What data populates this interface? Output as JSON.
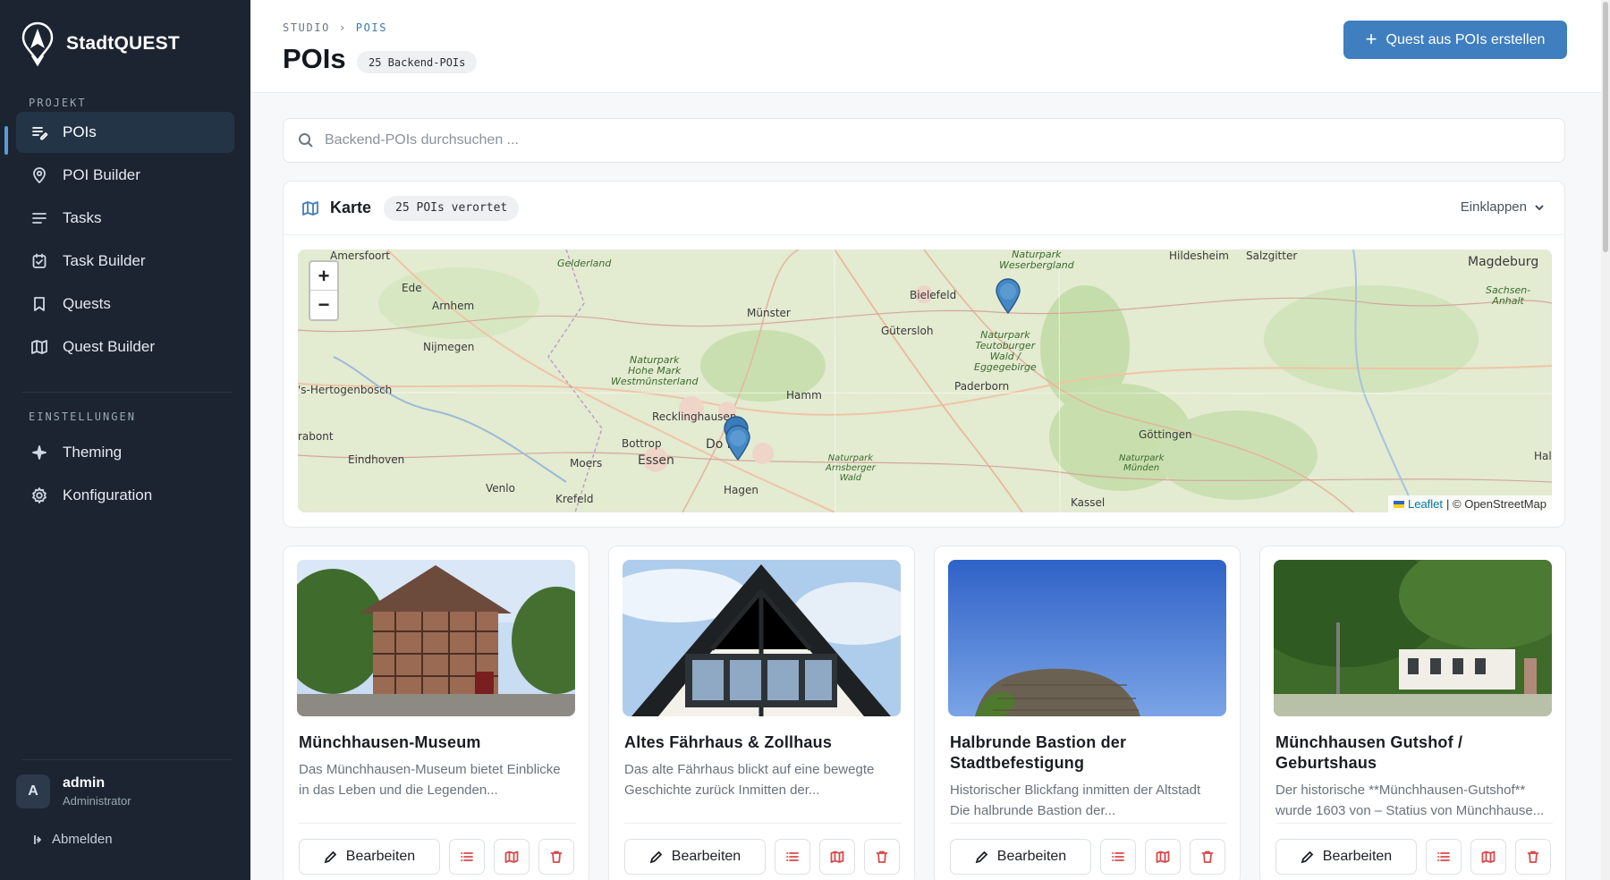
{
  "app": {
    "name": "StadtQUEST"
  },
  "sidebar": {
    "section_project": "PROJEKT",
    "section_settings": "EINSTELLUNGEN",
    "project_items": [
      {
        "label": "POIs",
        "icon": "list-edit-icon",
        "active": true
      },
      {
        "label": "POI Builder",
        "icon": "map-pin-icon"
      },
      {
        "label": "Tasks",
        "icon": "lines-icon"
      },
      {
        "label": "Task Builder",
        "icon": "calendar-check-icon"
      },
      {
        "label": "Quests",
        "icon": "bookmark-icon"
      },
      {
        "label": "Quest Builder",
        "icon": "map-icon"
      }
    ],
    "settings_items": [
      {
        "label": "Theming",
        "icon": "sparkle-icon"
      },
      {
        "label": "Konfiguration",
        "icon": "gear-icon"
      }
    ],
    "user": {
      "initial": "A",
      "name": "admin",
      "role": "Administrator"
    },
    "logout": "Abmelden"
  },
  "header": {
    "breadcrumb": [
      "STUDIO",
      "POIS"
    ],
    "title": "POIs",
    "count_badge": "25 Backend-POIs",
    "primary_action": "Quest aus POIs erstellen"
  },
  "search": {
    "placeholder": "Backend-POIs durchsuchen ..."
  },
  "map": {
    "title": "Karte",
    "badge": "25 POIs verortet",
    "collapse_label": "Einklappen",
    "zoom_in": "+",
    "zoom_out": "−",
    "attribution_link": "Leaflet",
    "attribution_text": "| © OpenStreetMap",
    "labels": {
      "amersfoort": "Amersfoort",
      "gelderland": "Gelderland",
      "ede": "Ede",
      "arnhem": "Arnhem",
      "nijmegen": "Nijmegen",
      "hertogenbosch": "'s-Hertogenbosch",
      "eindhoven": "Eindhoven",
      "venlo": "Venlo",
      "krefeld": "Krefeld",
      "moers": "Moers",
      "essen": "Essen",
      "bottrop": "Bottrop",
      "recklinghausen": "Recklinghausen",
      "dortmund": "Do        nd",
      "hagen": "Hagen",
      "hamm": "Hamm",
      "muenster": "Münster",
      "guetersloh": "Gütersloh",
      "bielefeld": "Bielefeld",
      "paderborn": "Paderborn",
      "kassel": "Kassel",
      "goettingen": "Göttingen",
      "hildesheim": "Hildesheim",
      "salzgitter": "Salzgitter",
      "magdeburg": "Magdeburg",
      "sachsen_anhalt": "Sachsen-\nAnhalt",
      "halle": "Hall",
      "park_hohe_mark": "Naturpark\nHohe Mark\nWestmünsterland",
      "park_teutoburger": "Naturpark\nTeutoburger\nWald /\nEggegebirge",
      "park_weserbergland": "Naturpark\nWeserbergland",
      "park_arnsberger": "Naturpark\nArnsberger\nWald",
      "park_muenden": "Naturpark\nMünden",
      "rabont": "rabont"
    }
  },
  "pois": [
    {
      "title": "Münchhausen-Museum",
      "description": "Das Münchhausen-Museum bietet Einblicke in das Leben und die Legenden...",
      "edit_label": "Bearbeiten"
    },
    {
      "title": "Altes Fährhaus & Zollhaus",
      "description": "Das alte Fährhaus blickt auf eine bewegte Geschichte zurück Inmitten der...",
      "edit_label": "Bearbeiten"
    },
    {
      "title": "Halbrunde Bastion der Stadtbefestigung",
      "description": "Historischer Blickfang inmitten der Altstadt Die halbrunde Bastion der...",
      "edit_label": "Bearbeiten"
    },
    {
      "title": "Münchhausen Gutshof / Geburtshaus",
      "description": "Der historische **Münchhausen-Gutshof** wurde 1603 von – Statius von Münchhause...",
      "edit_label": "Bearbeiten"
    }
  ],
  "colors": {
    "sidebar_bg": "#1b2430",
    "accent": "#3f7fc0",
    "danger": "#d64a4a"
  }
}
